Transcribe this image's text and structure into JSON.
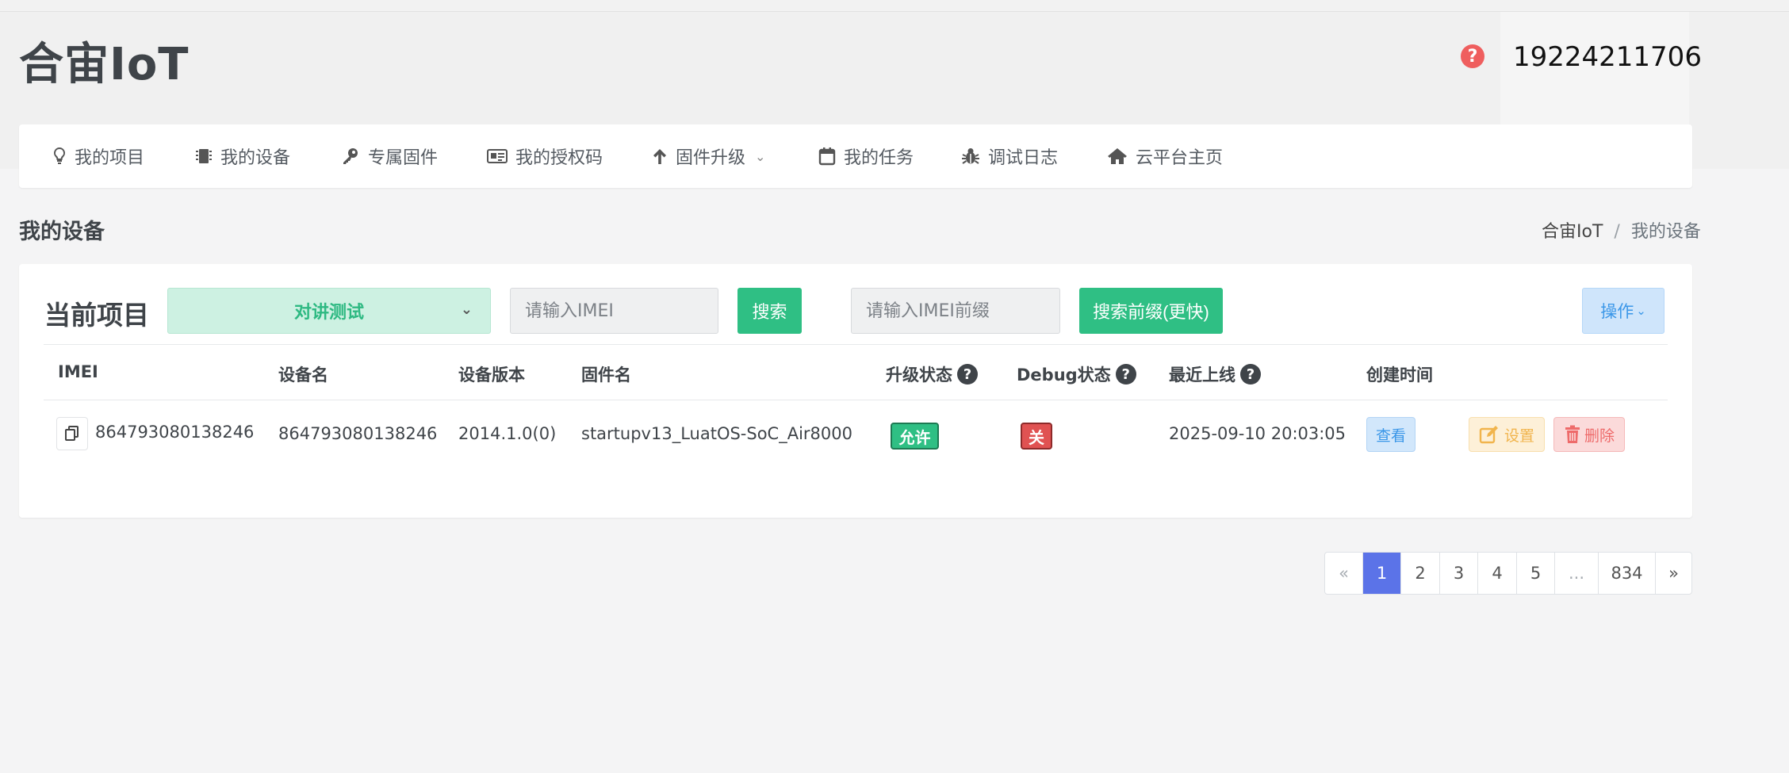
{
  "app": {
    "brand": "合宙IoT",
    "user": "19224211706",
    "help_icon": "question-circle-icon"
  },
  "nav": [
    {
      "label": "我的项目",
      "icon": "lightbulb-icon"
    },
    {
      "label": "我的设备",
      "icon": "chip-icon"
    },
    {
      "label": "专属固件",
      "icon": "key-icon"
    },
    {
      "label": "我的授权码",
      "icon": "id-card-icon"
    },
    {
      "label": "固件升级",
      "icon": "arrow-up-icon",
      "has_dropdown": true
    },
    {
      "label": "我的任务",
      "icon": "calendar-icon"
    },
    {
      "label": "调试日志",
      "icon": "bug-icon"
    },
    {
      "label": "云平台主页",
      "icon": "home-icon"
    }
  ],
  "page": {
    "title": "我的设备",
    "breadcrumb": {
      "home": "合宙IoT",
      "sep": "/",
      "current": "我的设备"
    }
  },
  "filters": {
    "project_label": "当前项目",
    "project_selected": "对讲测试",
    "imei_placeholder": "请输入IMEI",
    "search_label": "搜索",
    "prefix_placeholder": "请输入IMEI前缀",
    "prefix_search_label": "搜索前缀(更快)",
    "operation_label": "操作"
  },
  "table": {
    "headers": {
      "imei": "IMEI",
      "name": "设备名",
      "version": "设备版本",
      "firmware": "固件名",
      "upgrade": "升级状态",
      "debug": "Debug状态",
      "online": "最近上线",
      "created": "创建时间"
    },
    "rows": [
      {
        "imei": "864793080138246",
        "name": "864793080138246",
        "version": "2014.1.0(0)",
        "firmware": "startupv13_LuatOS-SoC_Air8000",
        "upgrade": "允许",
        "debug": "关",
        "online": "2025-09-10 20:03:05",
        "view": "查看",
        "settings": "设置",
        "delete": "删除"
      }
    ]
  },
  "pagination": {
    "prev": "«",
    "pages": [
      "1",
      "2",
      "3",
      "4",
      "5",
      "...",
      "834"
    ],
    "next": "»",
    "current": "1"
  },
  "colors": {
    "accent_green": "#2fbf84",
    "upgrade_badge": "#2fbf84",
    "debug_badge": "#e05252",
    "active_page": "#5b73e8"
  }
}
